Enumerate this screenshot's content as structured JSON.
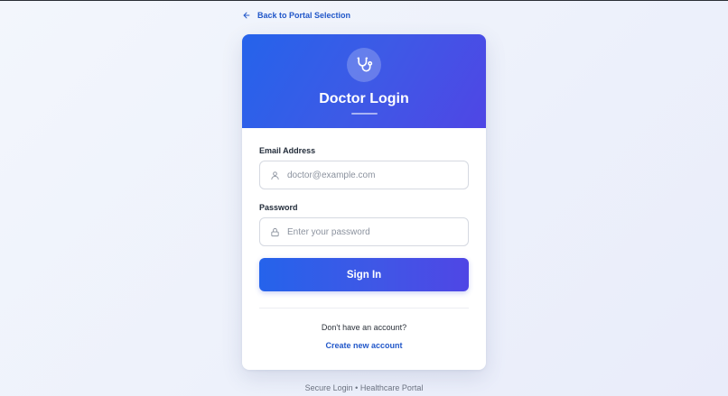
{
  "nav": {
    "back_label": "Back to Portal Selection"
  },
  "card": {
    "icon": "stethoscope-icon",
    "title": "Doctor Login"
  },
  "form": {
    "email": {
      "label": "Email Address",
      "placeholder": "doctor@example.com",
      "value": "",
      "icon": "user-icon"
    },
    "password": {
      "label": "Password",
      "placeholder": "Enter your password",
      "value": "",
      "icon": "lock-icon"
    },
    "submit_label": "Sign In"
  },
  "signup": {
    "prompt": "Don't have an account?",
    "link_label": "Create new account"
  },
  "footer": {
    "text": "Secure Login • Healthcare Portal"
  },
  "colors": {
    "primary": "#2563eb",
    "primary_end": "#4f46e5",
    "link": "#2157c9",
    "background": "#f0f3fb"
  }
}
